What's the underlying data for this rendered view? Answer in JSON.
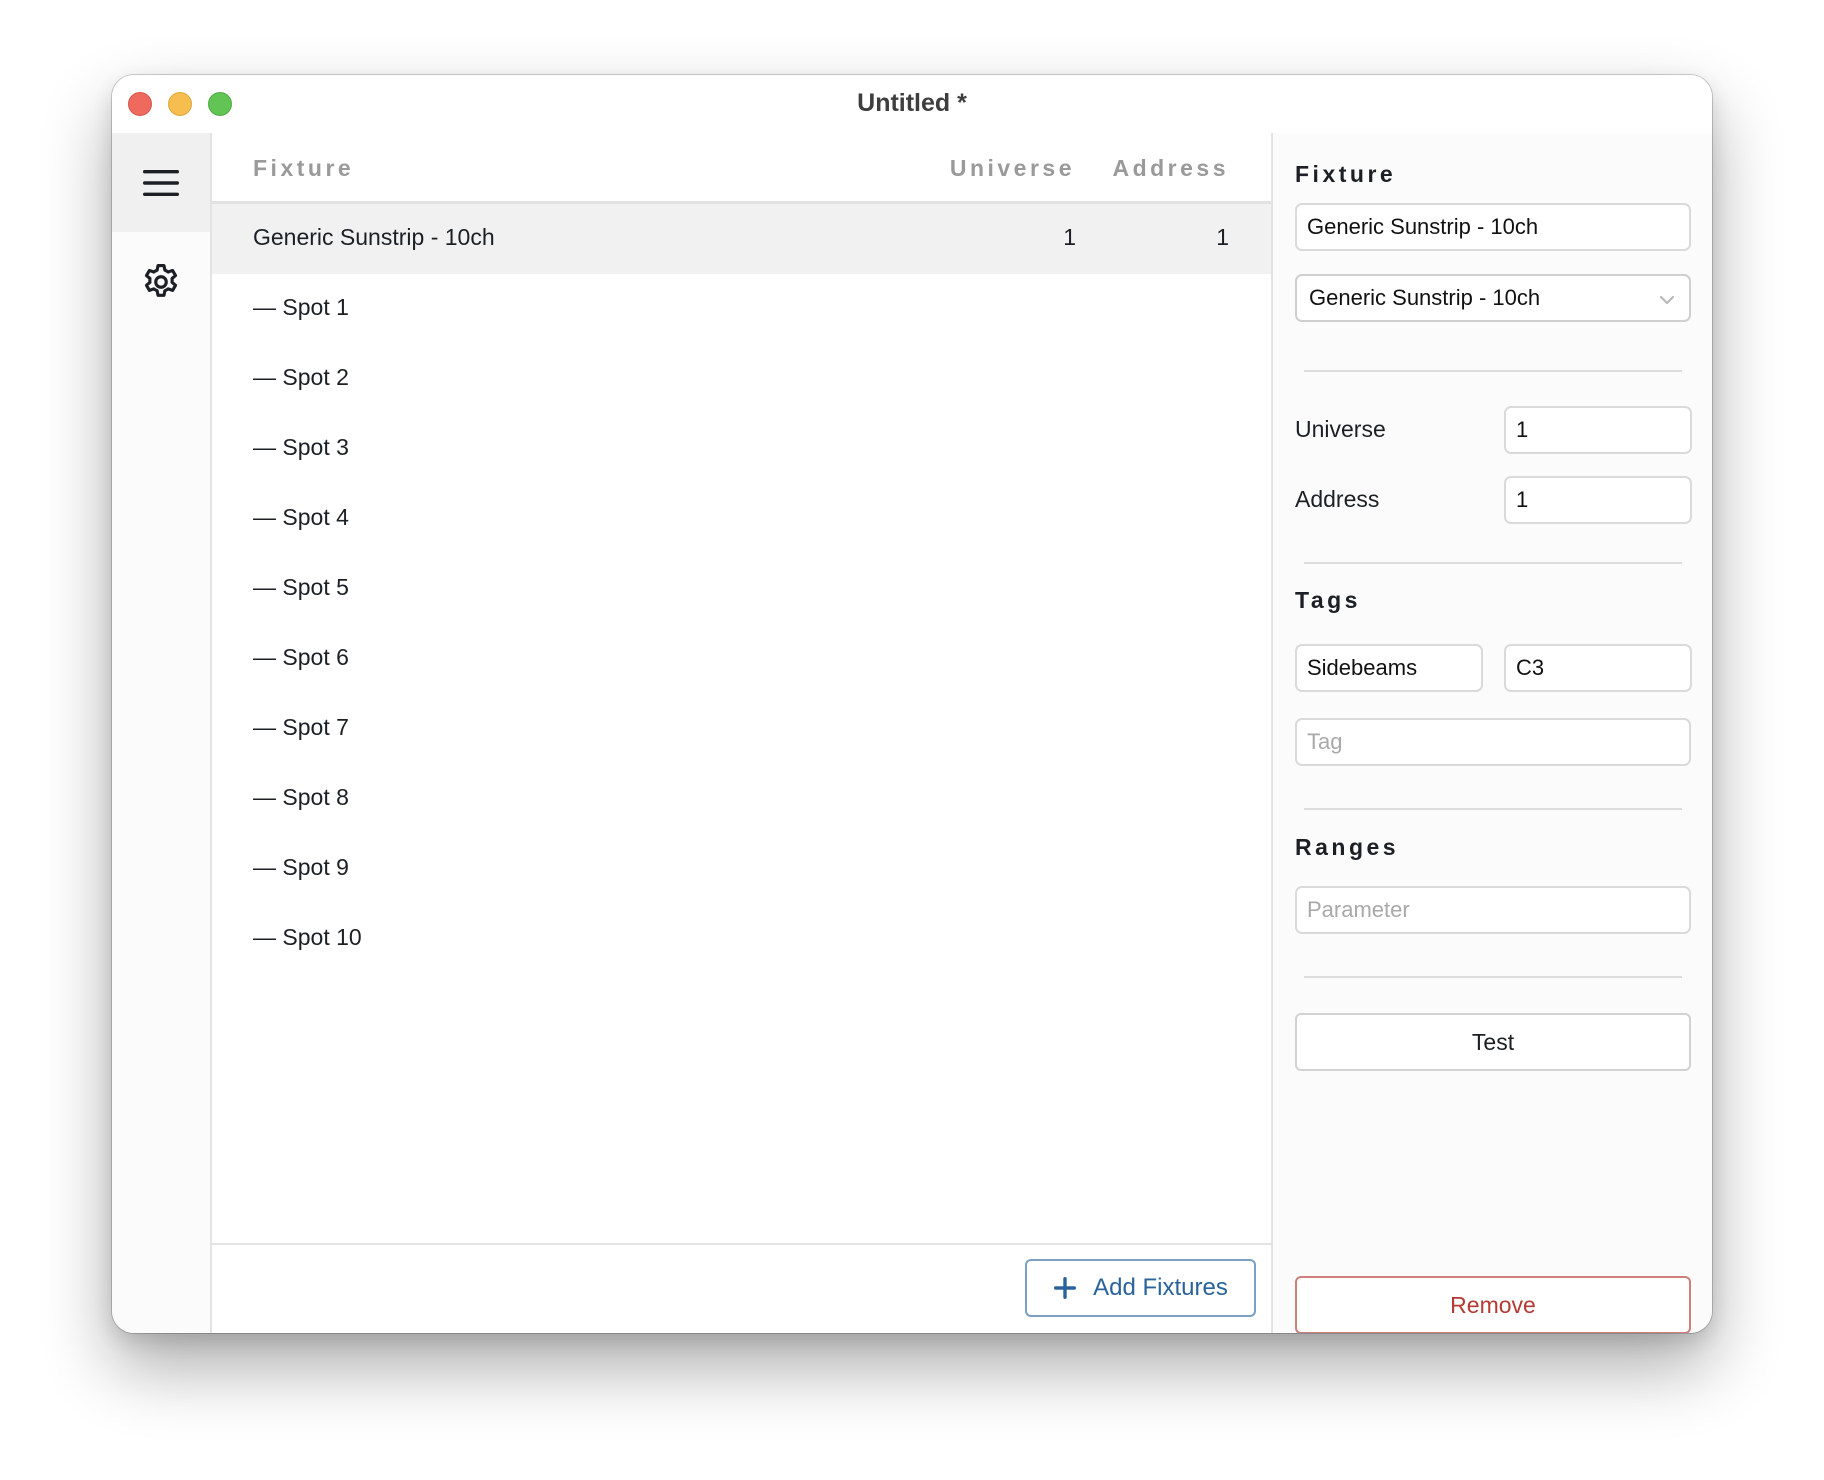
{
  "window": {
    "title": "Untitled *",
    "traffic_lights": {
      "close": "#ee6a5f",
      "minimize": "#f5be4f",
      "zoom": "#61c454"
    }
  },
  "sidebar": {
    "items": [
      {
        "icon": "hamburger-menu-icon",
        "active": true
      },
      {
        "icon": "gear-icon",
        "active": false
      }
    ]
  },
  "list": {
    "columns": [
      "Fixture",
      "Universe",
      "Address"
    ],
    "rows": [
      {
        "name": "Generic Sunstrip - 10ch",
        "universe": "1",
        "address": "1",
        "selected": true
      },
      {
        "name": "— Spot 1",
        "universe": "",
        "address": ""
      },
      {
        "name": "— Spot 2",
        "universe": "",
        "address": ""
      },
      {
        "name": "— Spot 3",
        "universe": "",
        "address": ""
      },
      {
        "name": "— Spot 4",
        "universe": "",
        "address": ""
      },
      {
        "name": "— Spot 5",
        "universe": "",
        "address": ""
      },
      {
        "name": "— Spot 6",
        "universe": "",
        "address": ""
      },
      {
        "name": "— Spot 7",
        "universe": "",
        "address": ""
      },
      {
        "name": "— Spot 8",
        "universe": "",
        "address": ""
      },
      {
        "name": "— Spot 9",
        "universe": "",
        "address": ""
      },
      {
        "name": "— Spot 10",
        "universe": "",
        "address": ""
      }
    ],
    "add_button": "Add Fixtures",
    "accent": "#2a639b"
  },
  "panel": {
    "fixture_heading": "Fixture",
    "fixture_name_value": "Generic Sunstrip - 10ch",
    "fixture_type_selected": "Generic Sunstrip - 10ch",
    "universe_label": "Universe",
    "universe_value": "1",
    "address_label": "Address",
    "address_value": "1",
    "tags_heading": "Tags",
    "tags": [
      "Sidebeams",
      "C3"
    ],
    "tag_placeholder": "Tag",
    "ranges_heading": "Ranges",
    "parameter_placeholder": "Parameter",
    "test_button": "Test",
    "remove_button": "Remove",
    "remove_color": "#b43a33"
  }
}
